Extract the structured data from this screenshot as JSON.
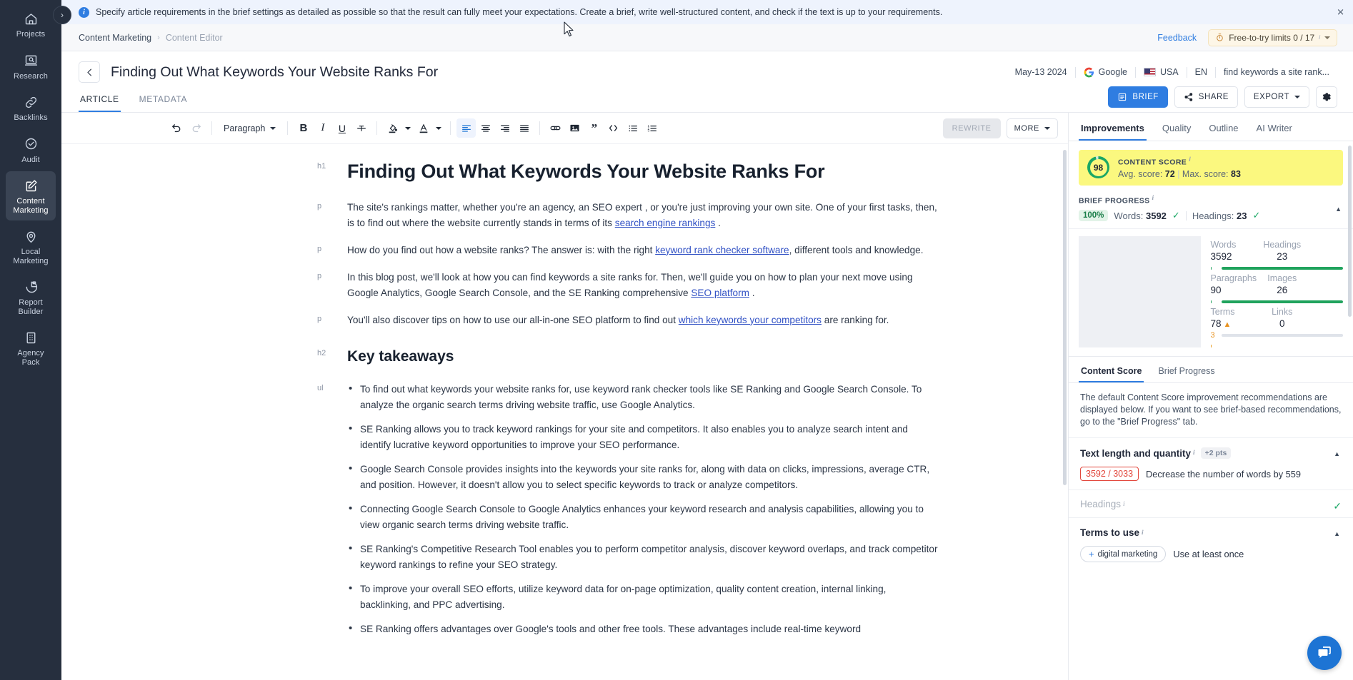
{
  "rail": {
    "toggle_label": "›",
    "items": [
      {
        "label": "Projects",
        "icon": "home-icon",
        "active": false
      },
      {
        "label": "Research",
        "icon": "research-icon",
        "active": false
      },
      {
        "label": "Backlinks",
        "icon": "link-icon",
        "active": false
      },
      {
        "label": "Audit",
        "icon": "check-circle-icon",
        "active": false
      },
      {
        "label": "Content\nMarketing",
        "icon": "pencil-square-icon",
        "active": true
      },
      {
        "label": "Local\nMarketing",
        "icon": "pin-icon",
        "active": false
      },
      {
        "label": "Report\nBuilder",
        "icon": "pie-chart-icon",
        "active": false
      },
      {
        "label": "Agency\nPack",
        "icon": "building-icon",
        "active": false
      }
    ]
  },
  "banner": {
    "text": "Specify article requirements in the brief settings as detailed as possible so that the result can fully meet your expectations. Create a brief, write well-structured content, and check if the text is up to your requirements.",
    "info_icon": "info-icon",
    "close_icon": "close-icon"
  },
  "breadcrumb": {
    "root": "Content Marketing",
    "separator": "›",
    "current": "Content Editor",
    "feedback": "Feedback",
    "limits_label": "Free-to-try limits 0 / 17",
    "limits_icon": "stopwatch-icon"
  },
  "document": {
    "back_icon": "arrow-left-icon",
    "title": "Finding Out What Keywords Your Website Ranks For",
    "meta": {
      "date": "May-13 2024",
      "engine": "Google",
      "engine_icon": "google-icon",
      "country": "USA",
      "country_icon": "usa-flag-icon",
      "language": "EN",
      "keyword": "find keywords a site rank..."
    }
  },
  "doc_tabs": [
    {
      "label": "ARTICLE",
      "active": true
    },
    {
      "label": "METADATA",
      "active": false
    }
  ],
  "actions": {
    "brief": "BRIEF",
    "brief_icon": "list-icon",
    "share": "SHARE",
    "share_icon": "share-icon",
    "export": "EXPORT",
    "export_caret": "chevron-down-icon",
    "settings_icon": "gear-icon"
  },
  "editor_toolbar": {
    "undo": "undo-icon",
    "redo": "redo-icon",
    "block_format": "Paragraph",
    "bold": "B",
    "italic": "I",
    "underline": "U",
    "strikethrough": "strikethrough-icon",
    "highlight": "highlight-color-icon",
    "text_color": "A",
    "align_left": "align-left-icon",
    "align_center": "align-center-icon",
    "align_right": "align-right-icon",
    "align_justify": "align-justify-icon",
    "link": "link-icon",
    "image": "image-icon",
    "quote": "quote-icon",
    "code": "code-icon",
    "bullet_list": "bullet-list-icon",
    "numbered_list": "numbered-list-icon",
    "rewrite": "REWRITE",
    "more": "MORE"
  },
  "article": {
    "blocks": [
      {
        "marker": "h1",
        "type": "h1",
        "text": "Finding Out What Keywords Your Website Ranks For"
      },
      {
        "marker": "p",
        "type": "p",
        "parts": [
          {
            "t": "The site's rankings matter, whether you're an agency, an SEO expert , or you're just improving your own site. One of your first tasks, then, is to find out where the website currently stands in terms of its "
          },
          {
            "t": "search engine rankings",
            "link": true
          },
          {
            "t": " ."
          }
        ]
      },
      {
        "marker": "p",
        "type": "p",
        "parts": [
          {
            "t": "How do you find out how a website ranks? The answer is: with the right "
          },
          {
            "t": "keyword rank checker software",
            "link": true
          },
          {
            "t": ", different tools and knowledge."
          }
        ]
      },
      {
        "marker": "p",
        "type": "p",
        "parts": [
          {
            "t": "In this blog post, we'll look at how you can find keywords a site ranks for. Then, we'll guide you on how to plan your next move using Google Analytics, Google Search Console, and the SE Ranking comprehensive "
          },
          {
            "t": "SEO platform",
            "link": true
          },
          {
            "t": " ."
          }
        ]
      },
      {
        "marker": "p",
        "type": "p",
        "parts": [
          {
            "t": "You'll also discover tips on how to use our all-in-one SEO platform to find out "
          },
          {
            "t": "which keywords your competitors",
            "link": true
          },
          {
            "t": " are ranking for."
          }
        ]
      },
      {
        "marker": "h2",
        "type": "h2",
        "text": "Key takeaways"
      },
      {
        "marker": "ul",
        "type": "ul",
        "items": [
          "To find out what keywords your website ranks for, use keyword rank checker tools like SE Ranking and Google Search Console. To analyze the organic search terms driving website traffic, use Google Analytics.",
          "SE Ranking allows you to track keyword rankings for your site and competitors. It also enables you to analyze search intent and identify lucrative keyword opportunities to improve your SEO performance.",
          "Google Search Console provides insights into the keywords your site ranks for, along with data on clicks, impressions, average CTR, and position. However, it doesn't allow you to select specific keywords to track or analyze competitors.",
          "Connecting Google Search Console to Google Analytics enhances your keyword research and analysis capabilities, allowing you to view organic search terms driving website traffic.",
          "SE Ranking's Competitive Research Tool enables you to perform competitor analysis, discover keyword overlaps, and track competitor keyword rankings to refine your SEO strategy.",
          "To improve your overall SEO efforts, utilize keyword data for on-page optimization, quality content creation, internal linking, backlinking, and PPC advertising.",
          "SE Ranking offers advantages over Google's tools and other free tools. These advantages include real-time keyword"
        ]
      }
    ]
  },
  "panel": {
    "tabs": [
      {
        "label": "Improvements",
        "active": true
      },
      {
        "label": "Quality",
        "active": false
      },
      {
        "label": "Outline",
        "active": false
      },
      {
        "label": "AI Writer",
        "active": false
      }
    ],
    "content_score": {
      "caption": "CONTENT SCORE",
      "value": "98",
      "avg_label": "Avg. score:",
      "avg_value": "72",
      "max_label": "Max. score:",
      "max_value": "83",
      "highlight_color": "#fbf87f",
      "ring_color": "#1aa765"
    },
    "brief_progress": {
      "caption": "BRIEF PROGRESS",
      "percent": "100%",
      "words_label": "Words:",
      "words_value": "3592",
      "headings_label": "Headings:",
      "headings_value": "23",
      "check_icon": "check-icon",
      "collapse_icon": "chevron-up-icon"
    },
    "metrics": [
      {
        "label": "Words",
        "value": "3592",
        "bar_pct": 100,
        "bar_color": "#20a35d"
      },
      {
        "label": "Headings",
        "value": "23",
        "bar_pct": 100,
        "bar_color": "#20a35d"
      },
      {
        "label": "Paragraphs",
        "value": "90",
        "bar_pct": 100,
        "bar_color": "#20a35d"
      },
      {
        "label": "Images",
        "value": "26",
        "bar_pct": 100,
        "bar_color": "#20a35d"
      },
      {
        "label": "Terms",
        "value": "78",
        "delta": "▲ 3",
        "bar_pct": 96,
        "bar_color": "#eb9a1a"
      },
      {
        "label": "Links",
        "value": "0",
        "bar_pct": 0,
        "bar_color": "#dfe3ea"
      }
    ],
    "subtabs": [
      {
        "label": "Content Score",
        "active": true
      },
      {
        "label": "Brief Progress",
        "active": false
      }
    ],
    "note": "The default Content Score improvement recommendations are displayed below. If you want to see brief-based recommendations, go to the \"Brief Progress\" tab.",
    "sections": [
      {
        "title": "Text length and quantity",
        "points": "+2 pts",
        "badge": "3592 / 3033",
        "recommendation": "Decrease the number of words by 559",
        "toggle_icon": "chevron-up-icon"
      },
      {
        "title": "Headings",
        "done": true,
        "check_icon": "check-icon"
      },
      {
        "title": "Terms to use",
        "chip": "digital marketing",
        "chip_plus": "+",
        "chip_hint": "Use at least once",
        "toggle_icon": "chevron-up-icon"
      }
    ]
  },
  "chat": {
    "icon": "chat-bubbles-icon"
  }
}
